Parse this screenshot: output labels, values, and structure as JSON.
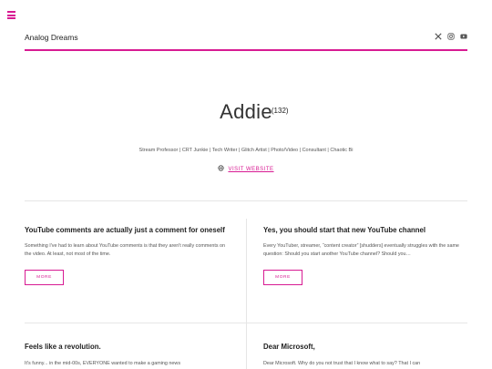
{
  "site": {
    "title": "Analog Dreams",
    "menu_icon": "hamburger-menu-icon",
    "socials": [
      {
        "name": "x-twitter-icon"
      },
      {
        "name": "instagram-icon"
      },
      {
        "name": "youtube-icon"
      }
    ],
    "accent_color": "#d81b93"
  },
  "author": {
    "name": "Addie",
    "count": "(132)",
    "bio": "Stream Professor | CRT Junkie | Tech Writer | Glitch Artist | Photo/Video | Consultant | Chaotic Bi",
    "website_label": "VISIT WEBSITE",
    "website_icon": "globe-icon"
  },
  "posts": [
    {
      "title": "YouTube comments are actually just a comment for oneself",
      "excerpt": "Something I've had to learn about YouTube comments is that they aren't really comments on the video. At least, not most of the time.",
      "more_label": "MORE"
    },
    {
      "title": "Yes, you should start that new YouTube channel",
      "excerpt": "Every YouTuber, streamer, “content creator” [shudders] eventually struggles with the same question: Should you start another YouTube channel? Should you…",
      "more_label": "MORE"
    },
    {
      "title": "Feels like a revolution.",
      "excerpt": "It's funny... in the mid-00s, EVERYONE wanted to make a gaming news"
    },
    {
      "title": "Dear Microsoft,",
      "excerpt": "Dear Microsoft. Why do you not trust that I know what to say? That I can"
    }
  ]
}
